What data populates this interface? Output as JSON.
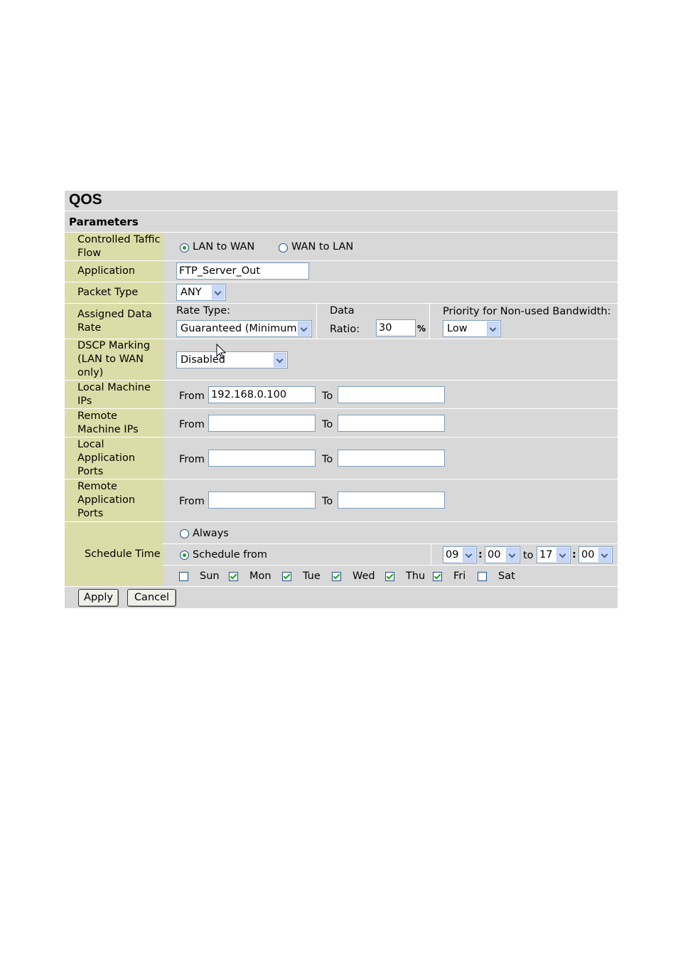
{
  "title": "QOS",
  "section": "Parameters",
  "labels": {
    "flow": "Controlled Taffic Flow",
    "application": "Application",
    "packet_type": "Packet Type",
    "data_rate": "Assigned Data Rate",
    "dscp": "DSCP Marking (LAN to WAN only)",
    "local_ips": "Local Machine IPs",
    "remote_ips": "Remote Machine IPs",
    "local_ports": "Local Application Ports",
    "remote_ports": "Remote Application Ports",
    "schedule": "Schedule Time"
  },
  "flow": {
    "option1": "LAN to WAN",
    "option2": "WAN to LAN",
    "selected": "LAN to WAN"
  },
  "application": {
    "value": "FTP_Server_Out"
  },
  "packet_type": {
    "value": "ANY"
  },
  "rate": {
    "rate_type_label": "Rate Type:",
    "rate_type_value": "Guaranteed (Minimum)",
    "data_label": "Data",
    "ratio_label": "Ratio:",
    "ratio_value": "30",
    "percent": "%",
    "priority_label": "Priority for Non-used Bandwidth:",
    "priority_value": "Low"
  },
  "dscp": {
    "value": "Disabled"
  },
  "ranges": {
    "from_label": "From",
    "to_label": "To",
    "local_ip_from": "192.168.0.100",
    "local_ip_to": "",
    "remote_ip_from": "",
    "remote_ip_to": "",
    "local_port_from": "",
    "local_port_to": "",
    "remote_port_from": "",
    "remote_port_to": ""
  },
  "schedule": {
    "always": "Always",
    "schedule_from": "Schedule from",
    "selected": "Schedule from",
    "start_hour": "09",
    "start_min": "00",
    "to": "to",
    "end_hour": "17",
    "end_min": "00",
    "colon": ":",
    "days": [
      {
        "label": "Sun",
        "checked": false
      },
      {
        "label": "Mon",
        "checked": true
      },
      {
        "label": "Tue",
        "checked": true
      },
      {
        "label": "Wed",
        "checked": true
      },
      {
        "label": "Thu",
        "checked": true
      },
      {
        "label": "Fri",
        "checked": true
      },
      {
        "label": "Sat",
        "checked": false
      }
    ]
  },
  "buttons": {
    "apply": "Apply",
    "cancel": "Cancel"
  },
  "colors": {
    "label_bg": "#dcdca8",
    "panel_bg": "#d8d8d8",
    "check": "#21a121"
  }
}
